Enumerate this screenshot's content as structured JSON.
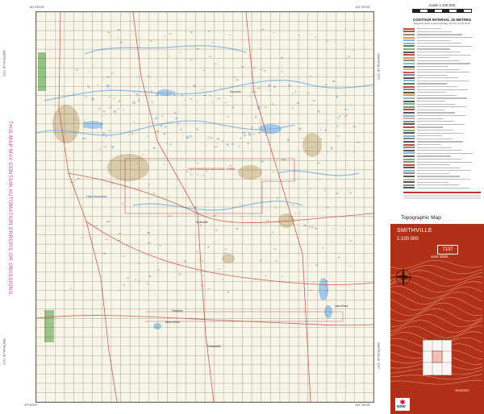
{
  "map": {
    "name": "SMITHVILLE",
    "scale": "1:100 000",
    "sheet_number": "7137",
    "edition_date": "June 2025",
    "datum": "GDA2020",
    "product_type": "Topographic Map",
    "side_warning": "THIS MAP MAY CONTAIN AUTOMATION ERRORS OR OMISSIONS.",
    "corner_tl": "141°00'00\"",
    "corner_tr": "141°30'00\"",
    "corner_bl": "29°30'00\"",
    "corner_br": "141°30'00\"",
    "sheet_label_left": "SMITHVILLE 7137",
    "sheet_label_right": "SMITHVILLE 7137",
    "publisher": "NSW"
  },
  "legend": {
    "scale_label": "Scale 1:100 000",
    "contour_interval": "CONTOUR INTERVAL 20 METRES",
    "contour_note": "Magnetic North is approximately 10.4°E of Grid North"
  },
  "places": {
    "reserve": "CAROWARRA NATIONAL PARK",
    "lake_1": "Lake Bancannia",
    "homestead_1": "Smithville",
    "homestead_2": "Kooroolia",
    "homestead_3": "Yandama",
    "homestead_4": "Mount Wood",
    "homestead_5": "Packsaddle",
    "homestead_6": "Lake Wood"
  },
  "colors": {
    "cover_red": "#b03018",
    "road_red": "#c8463a",
    "water_blue": "#7fb8e6",
    "vegetation_green": "#7cb56a",
    "sand_tan": "#c9b58c",
    "warning_magenta": "#d63aa0",
    "grid_dark": "#3d3d3d"
  },
  "icons": {
    "compass": "compass-rose-icon",
    "logo": "nsw-government-logo"
  }
}
